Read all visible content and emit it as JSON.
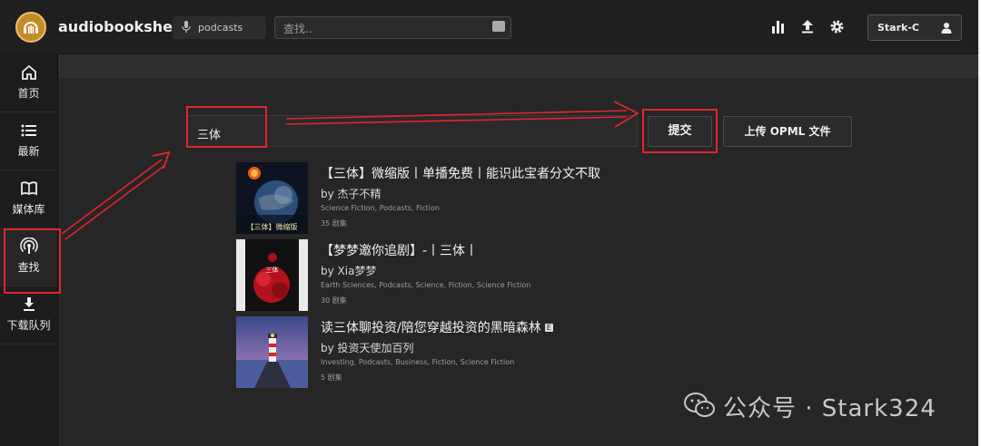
{
  "app": {
    "title": "audiobookshelf"
  },
  "topbar": {
    "library": "podcasts",
    "search_placeholder": "查找..",
    "user": "Stark-C"
  },
  "sidebar": {
    "items": [
      {
        "label": "首页",
        "icon": "home-icon"
      },
      {
        "label": "最新",
        "icon": "list-icon"
      },
      {
        "label": "媒体库",
        "icon": "book-icon"
      },
      {
        "label": "查找",
        "icon": "podcast-icon",
        "active": true
      },
      {
        "label": "下载队列",
        "icon": "download-icon"
      }
    ]
  },
  "search_form": {
    "query": "三体",
    "submit_label": "提交",
    "opml_label": "上传 OPML 文件"
  },
  "results": [
    {
      "title": "【三体】微缩版丨单播免费丨能识此宝者分文不取",
      "author": "by 杰子不精",
      "genres": "Science Fiction, Podcasts, Fiction",
      "episodes": "35 剧集",
      "explicit": false
    },
    {
      "title": "【梦梦邀你追剧】-丨三体丨",
      "author": "by Xia梦梦",
      "genres": "Earth Sciences, Podcasts, Science, Fiction, Science Fiction",
      "episodes": "30 剧集",
      "explicit": false
    },
    {
      "title": "读三体聊投资/陪您穿越投资的黑暗森林",
      "author": "by 投资天使加百列",
      "genres": "Investing, Podcasts, Business, Fiction, Science Fiction",
      "episodes": "5 剧集",
      "explicit": true,
      "explicit_badge": "E"
    }
  ],
  "covers": {
    "cover1_text": "【三体】微缩版",
    "cover2_text": "三体"
  },
  "watermark": "公众号 · Stark324",
  "colors": {
    "annotation": "#e0262b",
    "background": "#262626",
    "topbar": "#1f1f1f"
  }
}
